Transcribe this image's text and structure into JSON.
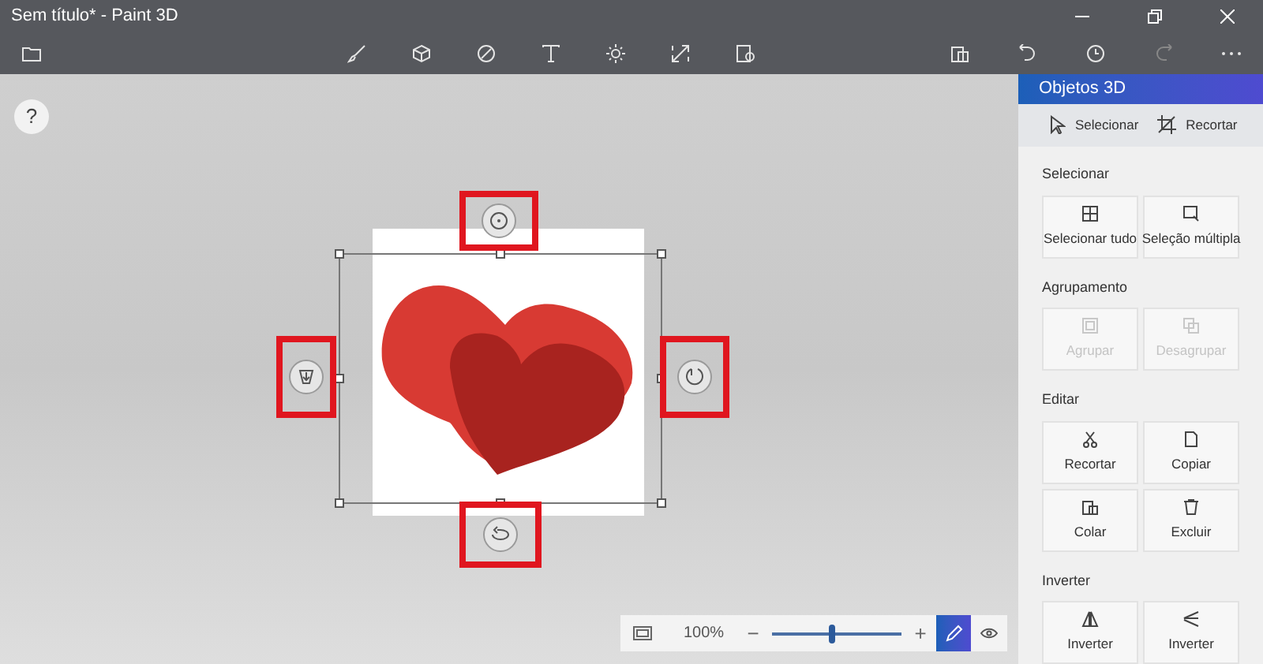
{
  "window": {
    "title": "Sem título* - Paint 3D"
  },
  "help": {
    "label": "?"
  },
  "rotation_controls": [
    {
      "kind": "top",
      "highlighted": true
    },
    {
      "kind": "left",
      "highlighted": true
    },
    {
      "kind": "right",
      "highlighted": true
    },
    {
      "kind": "bottom",
      "highlighted": true
    }
  ],
  "zoom_bar": {
    "zoom": "100%",
    "minus": "−",
    "plus": "+",
    "level": 0.46,
    "edit_view_selected": true
  },
  "panel": {
    "title": "Objetos 3D",
    "tools": [
      {
        "label": "Selecionar",
        "selected": false
      },
      {
        "label": "Recortar",
        "selected": false
      }
    ],
    "sections": [
      {
        "title": "Selecionar",
        "buttons": [
          {
            "label": "Selecionar tudo",
            "disabled": false
          },
          {
            "label": "Seleção múltipla",
            "disabled": false
          }
        ]
      },
      {
        "title": "Agrupamento",
        "buttons": [
          {
            "label": "Agrupar",
            "disabled": true
          },
          {
            "label": "Desagrupar",
            "disabled": true
          }
        ]
      },
      {
        "title": "Editar",
        "buttons": [
          {
            "label": "Recortar",
            "disabled": false
          },
          {
            "label": "Copiar",
            "disabled": false
          },
          {
            "label": "Colar",
            "disabled": false
          },
          {
            "label": "Excluir",
            "disabled": false
          }
        ]
      },
      {
        "title": "Inverter",
        "buttons": [
          {
            "label": "Inverter",
            "disabled": false
          },
          {
            "label": "Inverter",
            "disabled": false
          }
        ]
      }
    ]
  }
}
